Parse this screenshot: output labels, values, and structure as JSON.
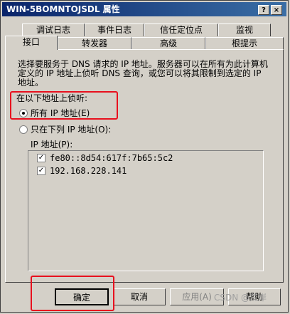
{
  "window": {
    "title": "WIN-5BOMNTOJSDL 属性",
    "help_glyph": "?",
    "close_glyph": "×"
  },
  "tabs_row1": [
    {
      "label": "调试日志"
    },
    {
      "label": "事件日志"
    },
    {
      "label": "信任定位点"
    },
    {
      "label": "监视"
    }
  ],
  "tabs_row2": [
    {
      "label": "接口",
      "active": true
    },
    {
      "label": "转发器"
    },
    {
      "label": "高级"
    },
    {
      "label": "根提示"
    }
  ],
  "content": {
    "description_line1": "选择要服务于 DNS 请求的 IP 地址。服务器可以在所有为此计算机",
    "description_line2": "定义的 IP 地址上侦听 DNS 查询，或您可以将其限制到选定的 IP",
    "description_line3": "地址。",
    "listen_label": "在以下地址上侦听:",
    "radio_all": "所有 IP 地址(E)",
    "radio_only": "只在下列 IP 地址(O):",
    "ip_list_label": "IP 地址(P):",
    "ip_addresses": [
      {
        "address": "fe80::8d54:617f:7b65:5c2",
        "checked": true
      },
      {
        "address": "192.168.228.141",
        "checked": true
      }
    ]
  },
  "buttons": {
    "ok": "确定",
    "cancel": "取消",
    "apply": "应用(A)",
    "help": "帮助"
  },
  "watermark": "CSDN @荒岸",
  "colors": {
    "titlebar": "#0a246a",
    "annotation_red": "#e8101e",
    "face": "#d4d0c8"
  }
}
